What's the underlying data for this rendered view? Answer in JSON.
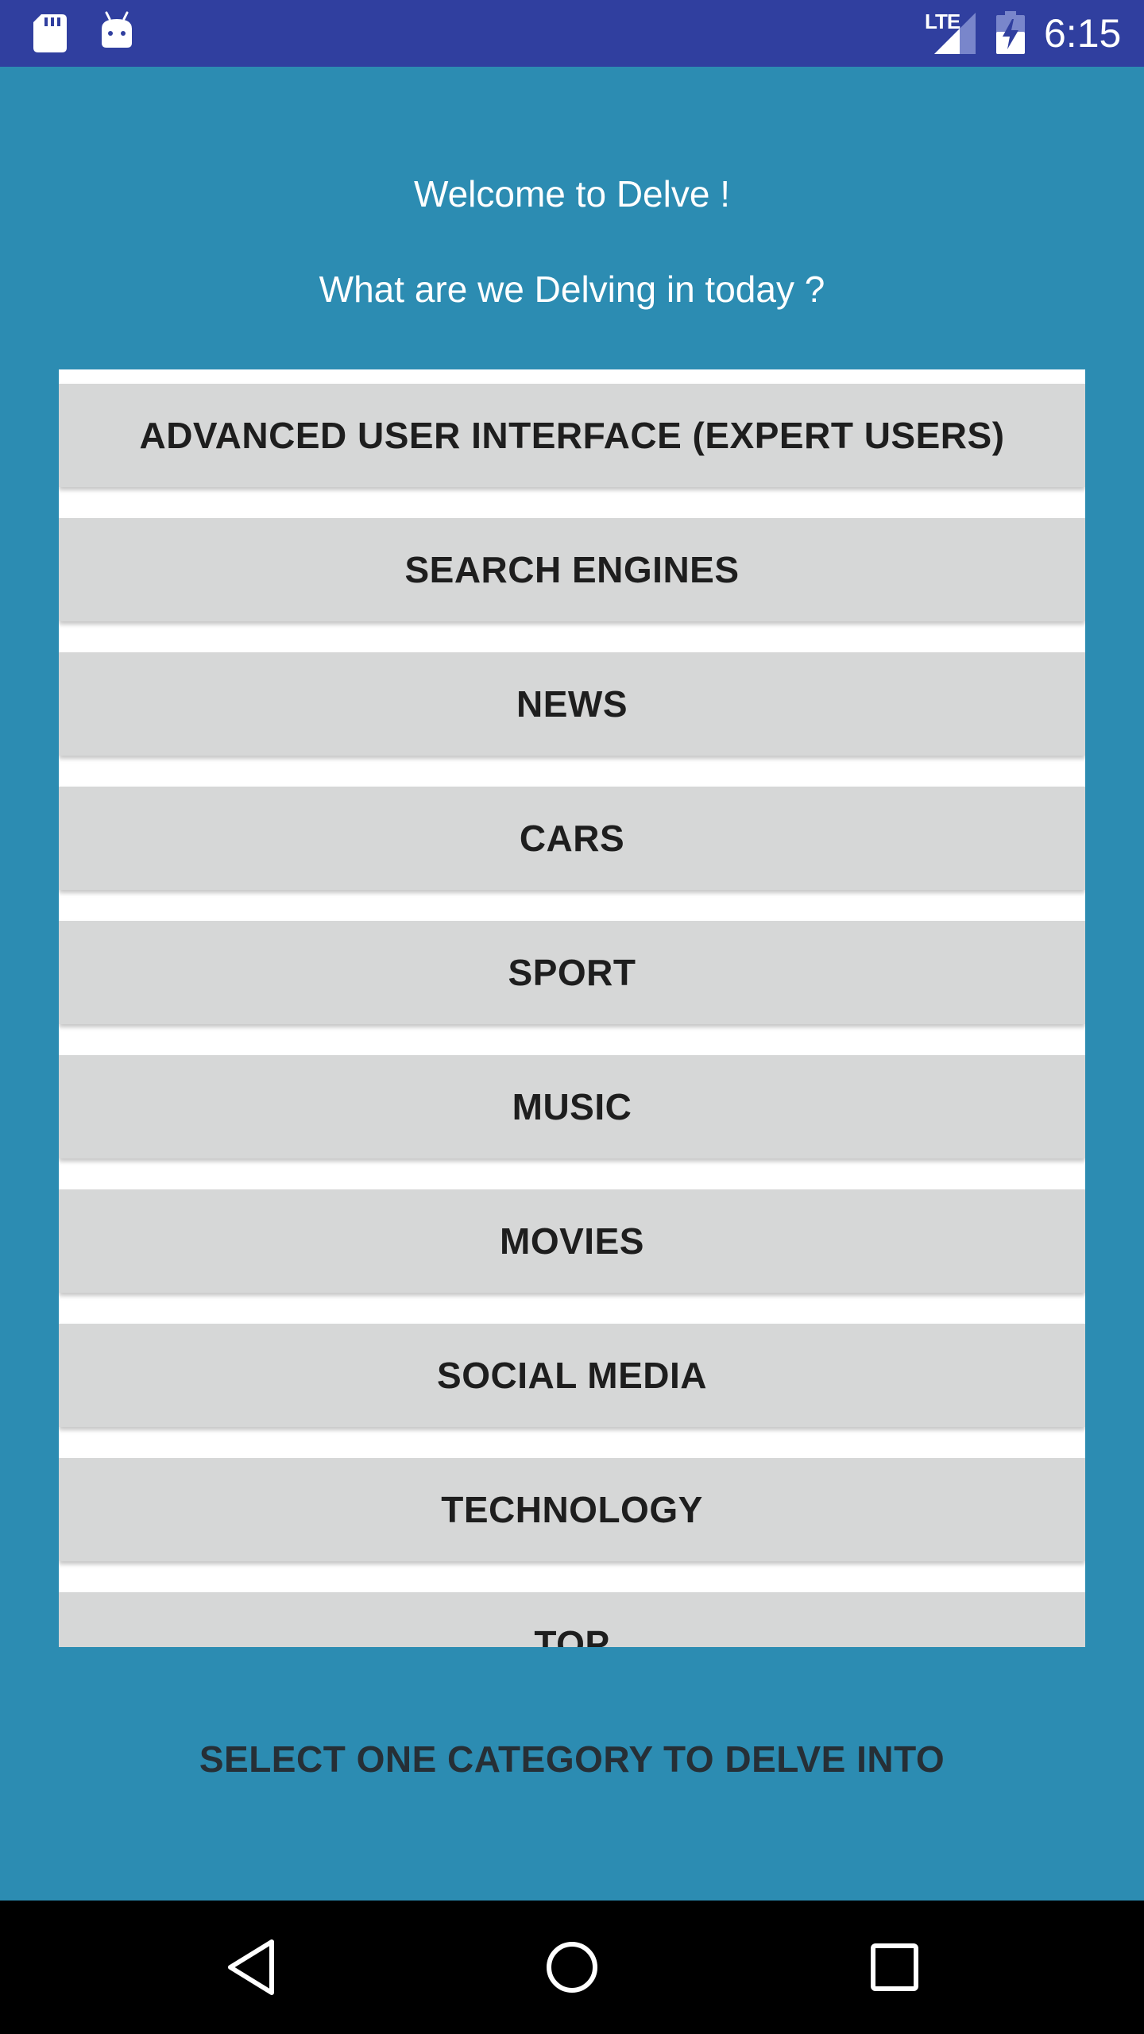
{
  "status_bar": {
    "network_label": "LTE",
    "time": "6:15",
    "icons": [
      "sd-card-icon",
      "android-debug-icon",
      "signal-icon",
      "battery-charging-icon"
    ]
  },
  "header": {
    "welcome": "Welcome to Delve !",
    "question": "What are we Delving in today ?"
  },
  "categories": [
    {
      "label": "ADVANCED USER INTERFACE (EXPERT USERS)"
    },
    {
      "label": "SEARCH ENGINES"
    },
    {
      "label": "NEWS"
    },
    {
      "label": "CARS"
    },
    {
      "label": "SPORT"
    },
    {
      "label": "MUSIC"
    },
    {
      "label": "MOVIES"
    },
    {
      "label": "SOCIAL MEDIA"
    },
    {
      "label": "TECHNOLOGY"
    },
    {
      "label": "TOP"
    }
  ],
  "footer": {
    "instruction": "SELECT ONE CATEGORY TO DELVE INTO"
  },
  "nav_bar": {
    "icons": [
      "back-icon",
      "home-icon",
      "recents-icon"
    ]
  },
  "colors": {
    "background": "#2C8CB2",
    "status_bar": "#303F9F",
    "button": "#D6D7D7",
    "list_background": "#FFFFFF"
  }
}
